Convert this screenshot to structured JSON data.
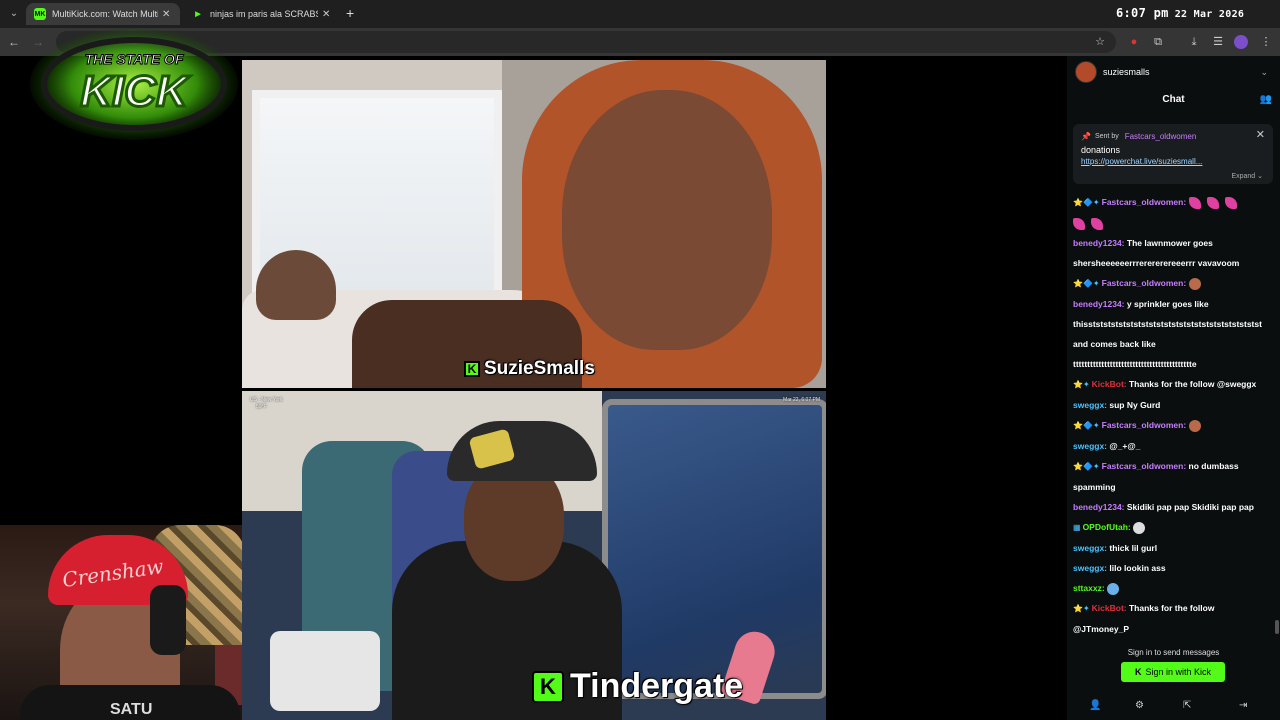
{
  "browser": {
    "tabs": [
      {
        "label": "MultiKick.com: Watch Multiple",
        "favicon": "MK",
        "active": true
      },
      {
        "label": "ninjas im paris ala SCRABSNYC",
        "favicon": "▶",
        "active": false
      }
    ],
    "clock": {
      "time": "6:07 pm",
      "date": "22 Mar 2026"
    }
  },
  "logo": {
    "alt": "THE STATE OF KICK",
    "line1": "THE STATE OF",
    "line2": "KICK",
    "glow": "#6dff1a"
  },
  "streams": {
    "top": {
      "name": "SuzieSmalls"
    },
    "bottom": {
      "name": "Tindergate",
      "location": "US - New York",
      "temp": "59°F",
      "date": "Mar 22, 6:07 PM"
    }
  },
  "webcam": {
    "hat_text": "Crenshaw",
    "shirt_text": "SATU"
  },
  "chat": {
    "channel": "suziesmalls",
    "title": "Chat",
    "pinned": {
      "sent_by": "Sent by",
      "sender": "Fastcars_oldwomen",
      "message": "donations",
      "link": "https://powerchat.live/suziesmall...",
      "expand": "Expand"
    },
    "messages": [
      {
        "badges": "⭐🔷✦",
        "user": "Fastcars_oldwomen",
        "color": "#c77dff",
        "text": "",
        "emotes": [
          "pink",
          "pink",
          "pink"
        ]
      },
      {
        "badges": "",
        "user": "",
        "color": "#fff",
        "text": "",
        "emotes": [
          "pink",
          "pink"
        ]
      },
      {
        "badges": "",
        "user": "benedy1234",
        "color": "#c77dff",
        "text": "The lawnmower goes"
      },
      {
        "badges": "",
        "user": "",
        "color": "#fff",
        "text": "shersheeeeeerrrerererereeerrr vavavoom"
      },
      {
        "badges": "⭐🔷✦",
        "user": "Fastcars_oldwomen",
        "color": "#c77dff",
        "text": "",
        "emotes": [
          "face"
        ]
      },
      {
        "badges": "",
        "user": "benedy1234",
        "color": "#c77dff",
        "text": "y sprinkler goes like"
      },
      {
        "badges": "",
        "user": "",
        "color": "#fff",
        "text": "thisststststststststststststststststststststststst"
      },
      {
        "badges": "",
        "user": "",
        "color": "#fff",
        "text": "and comes back like"
      },
      {
        "badges": "",
        "user": "",
        "color": "#fff",
        "text": "tttttttttttttttttttttttttttttttttttttttttte"
      },
      {
        "badges": "⭐✦",
        "user": "KickBot",
        "color": "#e0303a",
        "text": "Thanks for the follow @sweggx"
      },
      {
        "badges": "",
        "user": "sweggx",
        "color": "#4cc3ff",
        "text": "sup Ny Gurd"
      },
      {
        "badges": "⭐🔷✦",
        "user": "Fastcars_oldwomen",
        "color": "#c77dff",
        "text": "",
        "emotes": [
          "face"
        ]
      },
      {
        "badges": "",
        "user": "sweggx",
        "color": "#4cc3ff",
        "text": "@_+@_"
      },
      {
        "badges": "⭐🔷✦",
        "user": "Fastcars_oldwomen",
        "color": "#c77dff",
        "text": "no dumbass"
      },
      {
        "badges": "",
        "user": "",
        "color": "#fff",
        "text": "spamming"
      },
      {
        "badges": "",
        "user": "benedy1234",
        "color": "#c77dff",
        "text": "Skidiki pap pap Skidiki pap pap"
      },
      {
        "badges": "▦",
        "user": "OPDofUtah",
        "color": "#53fc18",
        "text": "",
        "emotes": [
          "white"
        ]
      },
      {
        "badges": "",
        "user": "sweggx",
        "color": "#4cc3ff",
        "text": "thick lil gurl"
      },
      {
        "badges": "",
        "user": "sweggx",
        "color": "#4cc3ff",
        "text": "lilo lookin ass"
      },
      {
        "badges": "",
        "user": "sttaxxz",
        "color": "#53fc18",
        "text": "",
        "emotes": [
          "blue"
        ]
      },
      {
        "badges": "⭐✦",
        "user": "KickBot",
        "color": "#e0303a",
        "text": "Thanks for the follow"
      },
      {
        "badges": "",
        "user": "",
        "color": "#fff",
        "text": "@JTmoney_P"
      }
    ],
    "signin_prompt": "Sign in to send messages",
    "signin_button": "Sign in with Kick"
  },
  "colors": {
    "kick_green": "#53fc18",
    "chat_bg": "#0b0e0f",
    "chrome_bg": "#1f1f1f"
  }
}
